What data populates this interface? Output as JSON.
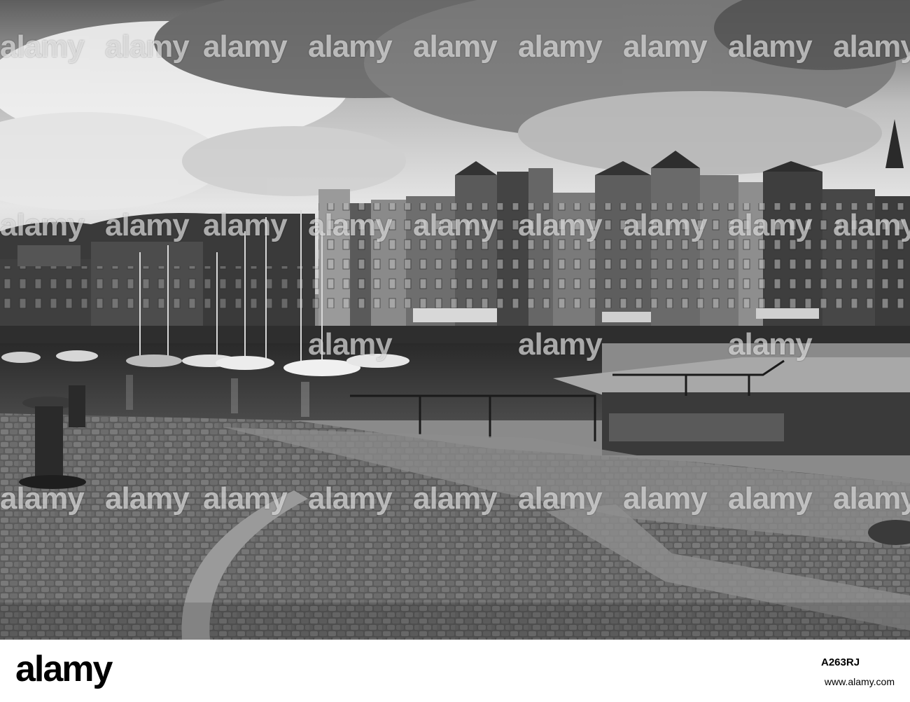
{
  "photo": {
    "subject": "harbor",
    "watermarks": [
      "alamy",
      "alamy",
      "alamy",
      "alamy",
      "alamy",
      "alamy",
      "alamy",
      "alamy",
      "alamy",
      "alamy",
      "alamy",
      "alamy",
      "alamy",
      "alamy",
      "alamy",
      "alamy",
      "alamy",
      "alamy",
      "alamy",
      "alamy",
      "alamy",
      "alamy",
      "alamy",
      "alamy",
      "alamy",
      "alamy",
      "alamy",
      "alamy",
      "alamy",
      "alamy",
      "alamy",
      "alamy"
    ]
  },
  "footer": {
    "brand": "alamy",
    "image_id": "A263RJ",
    "url": "www.alamy.com"
  },
  "colors": {
    "sky": "#d9d9d9",
    "water": "#3a3a3a",
    "cobbles": "#6e6e6e",
    "buildings": "#4a4a4a"
  }
}
